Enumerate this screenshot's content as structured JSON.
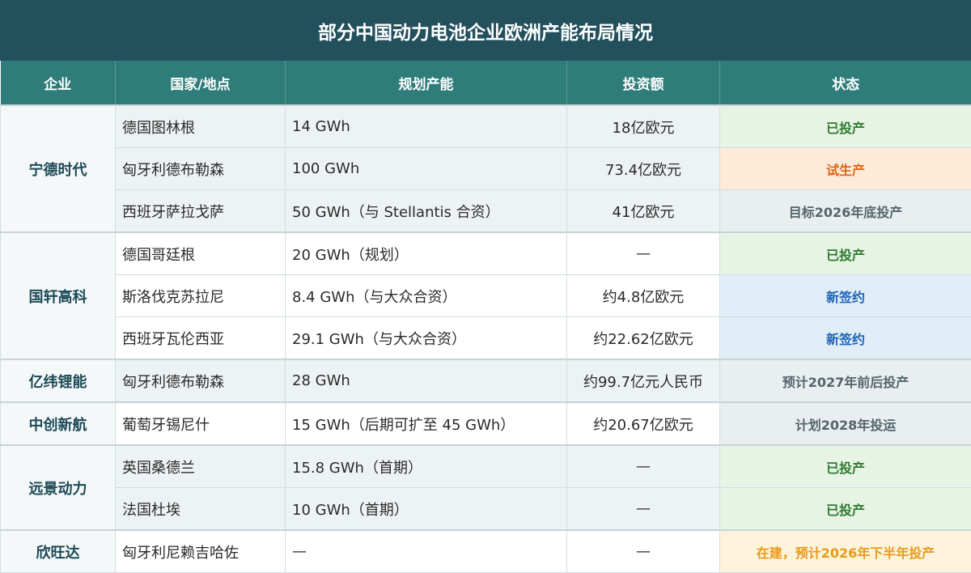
{
  "title": "部分中国动力电池企业欧洲产能布局情况",
  "headers": [
    "企业",
    "国家/地点",
    "规划产能",
    "投资额",
    "状态"
  ],
  "groups": [
    {
      "company": "宁德时代",
      "rows": [
        {
          "location": "德国图林根",
          "capacity": "14 GWh",
          "investment": "18亿欧元",
          "status": "已投产"
        },
        {
          "location": "匈牙利德布勒森",
          "capacity": "100 GWh",
          "investment": "73.4亿欧元",
          "status": "试生产"
        },
        {
          "location": "西班牙萨拉戈萨",
          "capacity": "50 GWh（与 Stellantis 合资）",
          "investment": "41亿欧元",
          "status": "目标2026年底投产"
        }
      ]
    },
    {
      "company": "国轩高科",
      "rows": [
        {
          "location": "德国哥廷根",
          "capacity": "20 GWh（规划）",
          "investment": "—",
          "status": "已投产"
        },
        {
          "location": "斯洛伐克苏拉尼",
          "capacity": "8.4 GWh（与大众合资）",
          "investment": "约4.8亿欧元",
          "status": "新签约"
        },
        {
          "location": "西班牙瓦伦西亚",
          "capacity": "29.1 GWh（与大众合资）",
          "investment": "约22.62亿欧元",
          "status": "新签约"
        }
      ]
    },
    {
      "company": "亿纬锂能",
      "rows": [
        {
          "location": "匈牙利德布勒森",
          "capacity": "28 GWh",
          "investment": "约99.7亿元人民币",
          "status": "预计2027年前后投产"
        }
      ]
    },
    {
      "company": "中创新航",
      "rows": [
        {
          "location": "葡萄牙锡尼什",
          "capacity": "15 GWh（后期可扩至 45 GWh）",
          "investment": "约20.67亿欧元",
          "status": "计划2028年投运"
        }
      ]
    },
    {
      "company": "远景动力",
      "rows": [
        {
          "location": "英国桑德兰",
          "capacity": "15.8 GWh（首期）",
          "investment": "—",
          "status": "已投产"
        },
        {
          "location": "法国杜埃",
          "capacity": "10 GWh（首期）",
          "investment": "—",
          "status": "已投产"
        }
      ]
    },
    {
      "company": "欣旺达",
      "rows": [
        {
          "location": "匈牙利尼赖吉哈佐",
          "capacity": "—",
          "investment": "—",
          "status": "在建，预计2026年下半年投产"
        }
      ]
    }
  ],
  "colors": {
    "title_bg": "#23505d",
    "header_bg": "#2f7d7a",
    "status_done": "#2f7a30",
    "status_trial": "#e06418",
    "status_new": "#1f63b8",
    "status_build": "#e89a1a",
    "status_neutral": "#54656b"
  }
}
